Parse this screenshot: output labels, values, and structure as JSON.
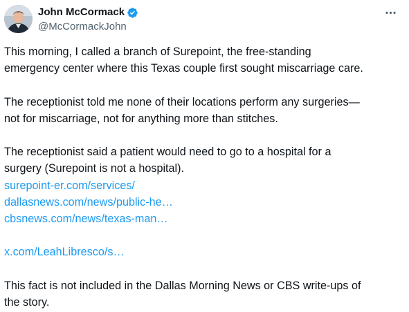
{
  "author": {
    "display_name": "John McCormack",
    "handle": "@McCormackJohn",
    "verified_icon": "verified-badge-icon",
    "avatar": "avatar-photo"
  },
  "menu": {
    "icon": "more-horizontal-icon"
  },
  "tweet": {
    "paragraph1": [
      "This morning, I called a branch of Surepoint, the free-standing",
      "emergency center where this Texas couple first sought miscarriage care."
    ],
    "paragraph2": [
      "The receptionist told me none of their locations perform any surgeries—",
      "not for miscarriage, not for anything more than stitches."
    ],
    "paragraph3": [
      "The receptionist said a patient would need to go to a hospital for a",
      "surgery (Surepoint is not a hospital)."
    ],
    "links": [
      "surepoint-er.com/services/",
      "dallasnews.com/news/public-he…",
      "cbsnews.com/news/texas-man…"
    ],
    "quote_link": "x.com/LeahLibresco/s…",
    "paragraph4": [
      "This fact is not included in the Dallas Morning News or CBS write-ups of",
      "the story."
    ]
  },
  "colors": {
    "text": "#0f1419",
    "secondary": "#536471",
    "link": "#1d9bf0",
    "verified": "#1d9bf0"
  }
}
